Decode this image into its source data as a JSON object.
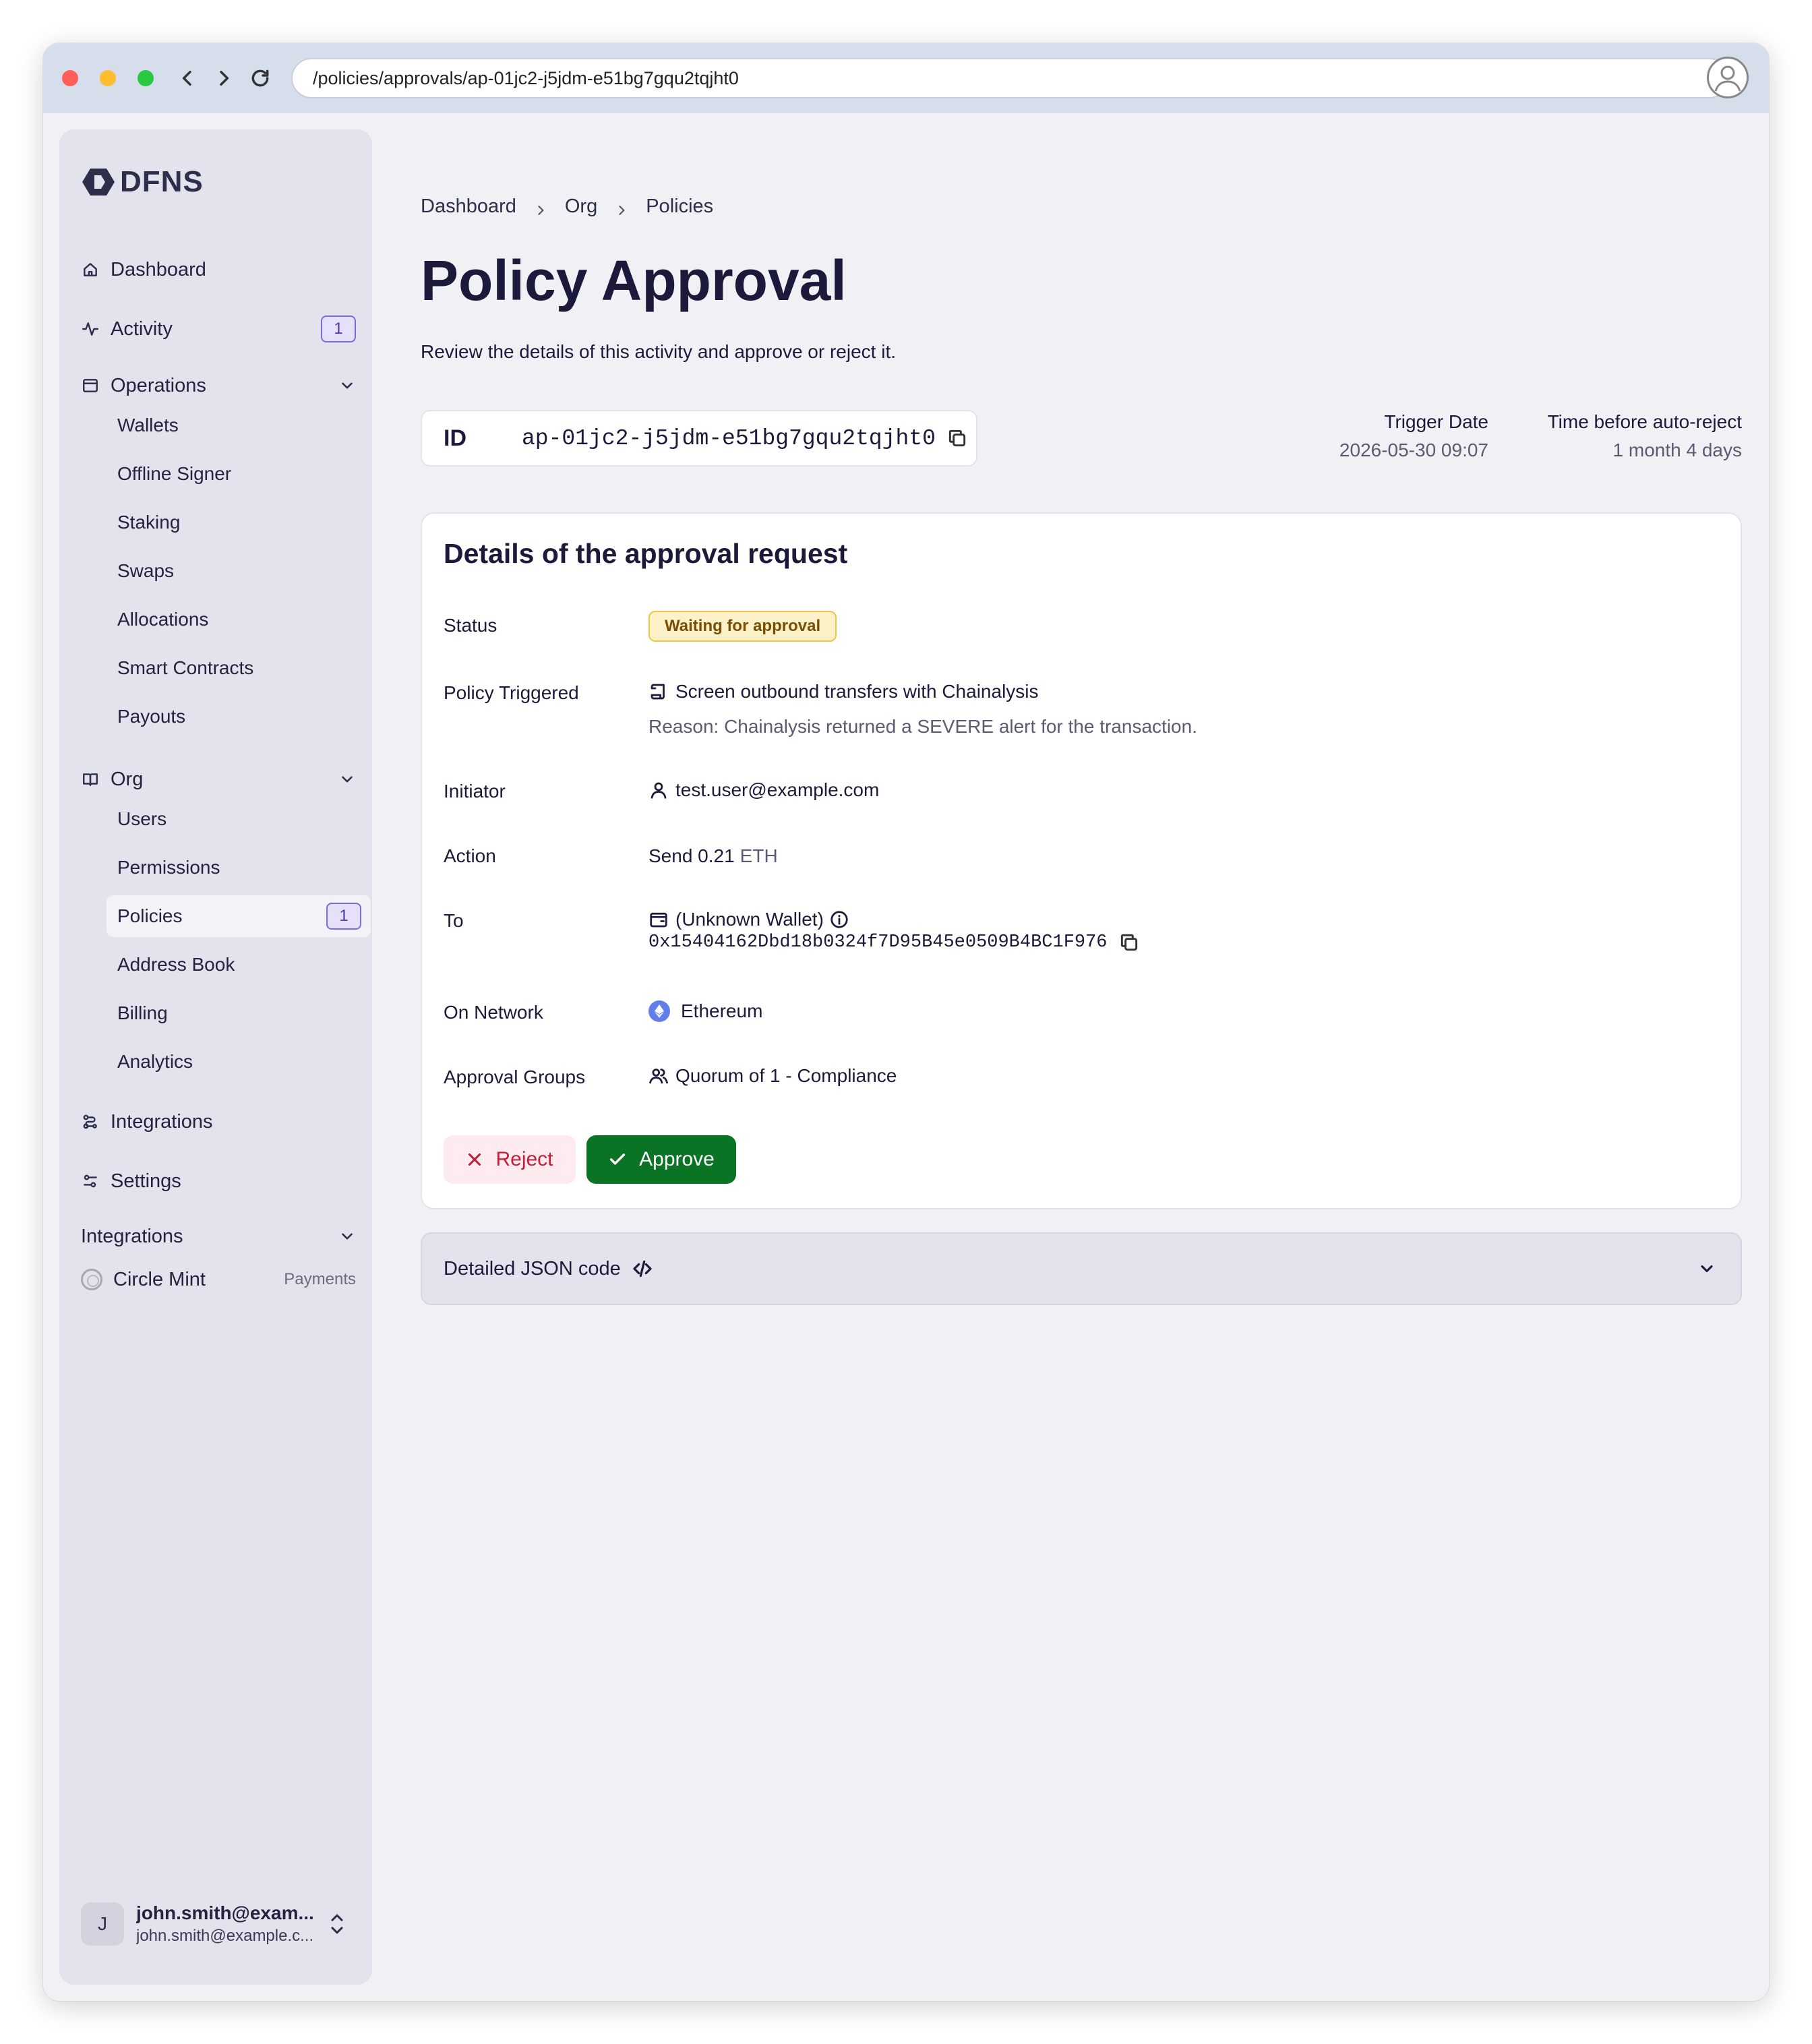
{
  "browser": {
    "url": "/policies/approvals/ap-01jc2-j5jdm-e51bg7gqu2tqjht0"
  },
  "brand": {
    "name": "DFNS"
  },
  "sidebar": {
    "top_items": [
      {
        "label": "Dashboard",
        "icon": "home-icon"
      },
      {
        "label": "Activity",
        "icon": "activity-icon",
        "badge": "1"
      }
    ],
    "operations": {
      "label": "Operations",
      "items": [
        "Wallets",
        "Offline Signer",
        "Staking",
        "Swaps",
        "Allocations",
        "Smart Contracts",
        "Payouts"
      ]
    },
    "org": {
      "label": "Org",
      "items": [
        "Users",
        "Permissions",
        "Policies",
        "Address Book",
        "Billing",
        "Analytics"
      ],
      "active": "Policies",
      "policies_badge": "1"
    },
    "bottom_items": [
      {
        "label": "Integrations",
        "icon": "integrations-icon"
      },
      {
        "label": "Settings",
        "icon": "settings-icon"
      }
    ],
    "integrations_section": {
      "label": "Integrations",
      "items": [
        {
          "label": "Circle Mint",
          "tag": "Payments"
        }
      ]
    },
    "user": {
      "initial": "J",
      "name": "john.smith@exam...",
      "email": "john.smith@example.c..."
    }
  },
  "breadcrumb": [
    "Dashboard",
    "Org",
    "Policies"
  ],
  "page": {
    "title": "Policy Approval",
    "subtitle": "Review the details of this activity and approve or reject it."
  },
  "approval": {
    "id_label": "ID",
    "id": "ap-01jc2-j5jdm-e51bg7gqu2tqjht0",
    "trigger_date_label": "Trigger Date",
    "trigger_date": "2026-05-30 09:07",
    "auto_reject_label": "Time before auto-reject",
    "auto_reject": "1 month 4 days"
  },
  "details": {
    "title": "Details of the approval request",
    "status_label": "Status",
    "status": "Waiting for approval",
    "policy_label": "Policy Triggered",
    "policy": "Screen outbound transfers with Chainalysis",
    "reason": "Reason: Chainalysis returned a SEVERE alert for the transaction.",
    "initiator_label": "Initiator",
    "initiator": "test.user@example.com",
    "action_label": "Action",
    "action": "Send 0.21",
    "action_unit": "ETH",
    "to_label": "To",
    "to_wallet": "(Unknown Wallet)",
    "to_address": "0x15404162Dbd18b0324f7D95B45e0509B4BC1F976",
    "network_label": "On Network",
    "network": "Ethereum",
    "groups_label": "Approval Groups",
    "groups": "Quorum of 1 - Compliance",
    "reject_label": "Reject",
    "approve_label": "Approve"
  },
  "json_section": {
    "label": "Detailed JSON code"
  },
  "colors": {
    "approve": "#0a7424",
    "reject": "#c41e3a",
    "status_bg": "#fdf1c7",
    "sidebar_bg": "#e2e3ec",
    "badge": "#7c6bd8"
  }
}
